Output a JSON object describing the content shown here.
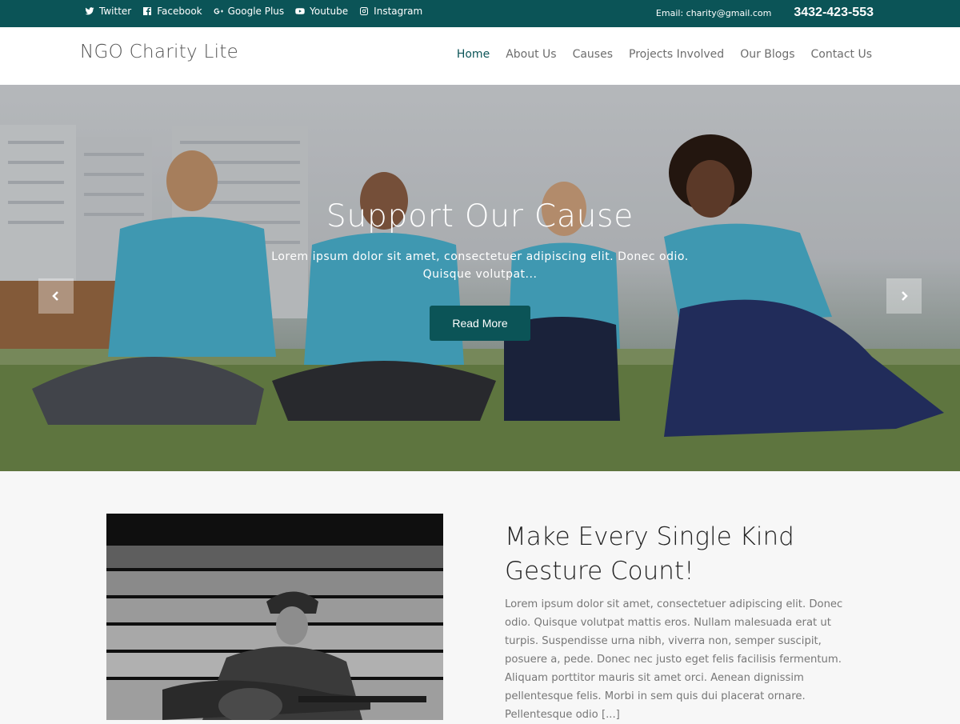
{
  "topbar": {
    "social": [
      {
        "label": "Twitter",
        "icon": "twitter-icon"
      },
      {
        "label": "Facebook",
        "icon": "facebook-icon"
      },
      {
        "label": "Google Plus",
        "icon": "google-plus-icon"
      },
      {
        "label": "Youtube",
        "icon": "youtube-icon"
      },
      {
        "label": "Instagram",
        "icon": "instagram-icon"
      }
    ],
    "email": "Email: charity@gmail.com",
    "phone": "3432-423-553"
  },
  "header": {
    "logo": "NGO Charity Lite",
    "nav": [
      "Home",
      "About Us",
      "Causes",
      "Projects Involved",
      "Our Blogs",
      "Contact Us"
    ],
    "active_nav": "Home"
  },
  "hero": {
    "title": "Support Our Cause",
    "text": "Lorem ipsum dolor sit amet, consectetuer adipiscing elit. Donec odio. Quisque volutpat...",
    "button": "Read More"
  },
  "about": {
    "title": "Make Every Single Kind Gesture Count!",
    "text": "Lorem ipsum dolor sit amet, consectetuer adipiscing elit. Donec odio. Quisque volutpat mattis eros. Nullam malesuada erat ut turpis. Suspendisse urna nibh, viverra non, semper suscipit, posuere a, pede. Donec nec justo eget felis facilisis fermentum. Aliquam porttitor mauris sit amet orci. Aenean dignissim pellentesque felis. Morbi in sem quis dui placerat ornare. Pellentesque odio [...]"
  },
  "colors": {
    "brand": "#0b5457",
    "nav_text": "#6d6d6d",
    "body_text": "#777777"
  }
}
